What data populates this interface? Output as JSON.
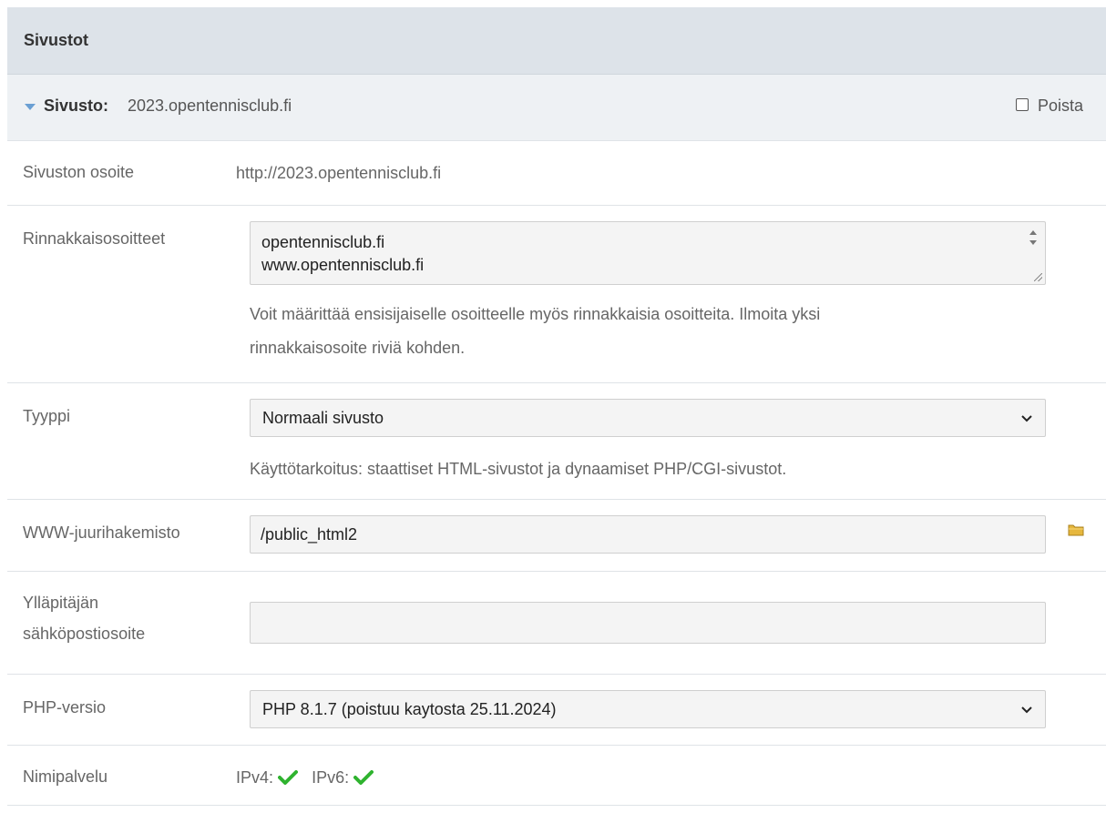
{
  "panel": {
    "title": "Sivustot"
  },
  "site": {
    "label": "Sivusto:",
    "name": "2023.opentennisclub.fi",
    "delete_label": "Poista"
  },
  "rows": {
    "address": {
      "label": "Sivuston osoite",
      "value": "http://2023.opentennisclub.fi"
    },
    "aliases": {
      "label": "Rinnakkaisosoitteet",
      "lines": [
        "opentennisclub.fi",
        "www.opentennisclub.fi"
      ],
      "help_line1": "Voit määrittää ensisijaiselle osoitteelle myös rinnakkaisia osoitteita. Ilmoita yksi",
      "help_line2": "rinnakkaisosoite riviä kohden."
    },
    "type": {
      "label": "Tyyppi",
      "selected": "Normaali sivusto",
      "help": "Käyttötarkoitus: staattiset HTML-sivustot ja dynaamiset PHP/CGI-sivustot."
    },
    "webroot": {
      "label": "WWW-juurihakemisto",
      "value": "/public_html2"
    },
    "admin_email": {
      "label_line1": "Ylläpitäjän",
      "label_line2": "sähköpostiosoite",
      "value": ""
    },
    "php": {
      "label": "PHP-versio",
      "selected": "PHP 8.1.7 (poistuu kaytosta 25.11.2024)"
    },
    "nameserver": {
      "label": "Nimipalvelu",
      "ipv4_label": "IPv4:",
      "ipv6_label": "IPv6:"
    }
  },
  "icons": {
    "toggle": "triangle-down-icon",
    "folder": "folder-icon",
    "check": "checkmark-icon",
    "select_arrow": "chevron-down-icon"
  },
  "colors": {
    "header_bg": "#dde3e9",
    "site_bar_bg": "#eef1f4",
    "toggle": "#6a9fd3",
    "check": "#2fb32f",
    "folder": "#e6b73d"
  }
}
